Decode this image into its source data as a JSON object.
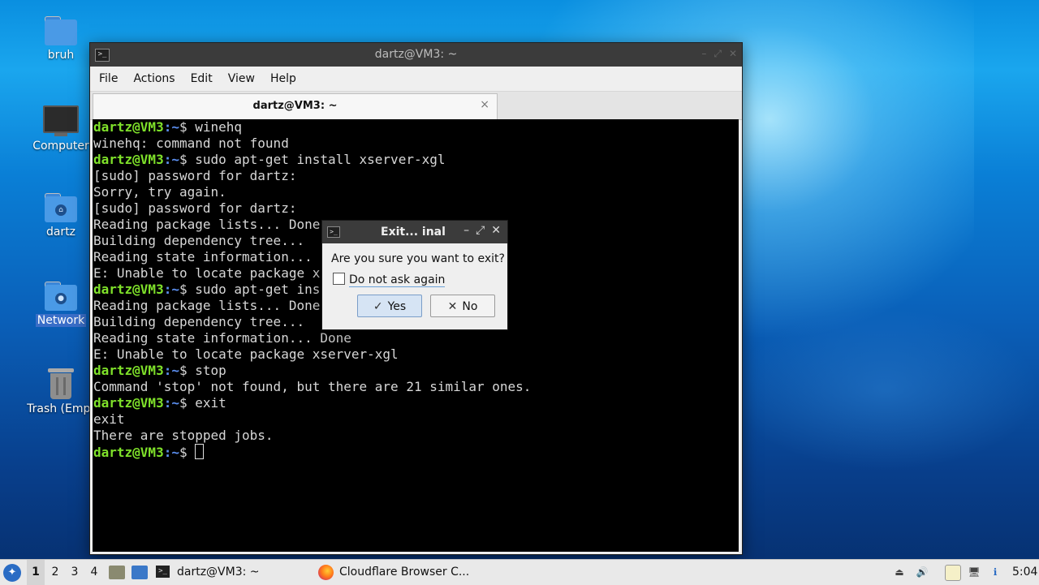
{
  "desktop": {
    "icons": [
      {
        "label": "bruh",
        "icon": "folder-icon"
      },
      {
        "label": "Computer",
        "icon": "computer-icon"
      },
      {
        "label": "dartz",
        "icon": "home-folder-icon"
      },
      {
        "label": "Network",
        "icon": "network-folder-icon",
        "selected": true
      },
      {
        "label": "Trash (Empt",
        "icon": "trash-icon"
      }
    ]
  },
  "terminal": {
    "window_title": "dartz@VM3: ~",
    "menu": [
      "File",
      "Actions",
      "Edit",
      "View",
      "Help"
    ],
    "tab_label": "dartz@VM3: ~",
    "tab_close": "×",
    "prompt_user": "dartz@VM3",
    "prompt_path": ":~",
    "prompt_sign": "$ ",
    "lines": [
      {
        "type": "cmd",
        "text": "winehq"
      },
      {
        "type": "out",
        "text": "winehq: command not found"
      },
      {
        "type": "cmd",
        "text": "sudo apt-get install xserver-xgl"
      },
      {
        "type": "out",
        "text": "[sudo] password for dartz:"
      },
      {
        "type": "out",
        "text": "Sorry, try again."
      },
      {
        "type": "out",
        "text": "[sudo] password for dartz:"
      },
      {
        "type": "out",
        "text": "Reading package lists... Done"
      },
      {
        "type": "out",
        "text": "Building dependency tree..."
      },
      {
        "type": "out",
        "text": "Reading state information..."
      },
      {
        "type": "out",
        "text": "E: Unable to locate package x"
      },
      {
        "type": "cmd",
        "text": "sudo apt-get ins"
      },
      {
        "type": "out",
        "text": "Reading package lists... Done"
      },
      {
        "type": "out",
        "text": "Building dependency tree..."
      },
      {
        "type": "out",
        "text": "Reading state information... Done"
      },
      {
        "type": "out",
        "text": "E: Unable to locate package xserver-xgl"
      },
      {
        "type": "cmd",
        "text": "stop"
      },
      {
        "type": "out",
        "text": "Command 'stop' not found, but there are 21 similar ones."
      },
      {
        "type": "cmd",
        "text": "exit"
      },
      {
        "type": "out",
        "text": "exit"
      },
      {
        "type": "out",
        "text": "There are stopped jobs."
      },
      {
        "type": "cmd",
        "text": "",
        "cursor": true
      }
    ]
  },
  "dialog": {
    "title": "Exit...   inal",
    "question": "Are you sure you want to exit?",
    "checkbox_label": "Do not ask again",
    "checkbox_checked": false,
    "yes_label": "Yes",
    "no_label": "No"
  },
  "taskbar": {
    "workspaces": [
      "1",
      "2",
      "3",
      "4"
    ],
    "active_workspace": "1",
    "tasks": [
      {
        "label": "dartz@VM3: ~",
        "icon": "terminal-icon"
      },
      {
        "label": "Cloudflare Browser C...",
        "icon": "firefox-icon"
      }
    ],
    "clock": "5:04"
  }
}
